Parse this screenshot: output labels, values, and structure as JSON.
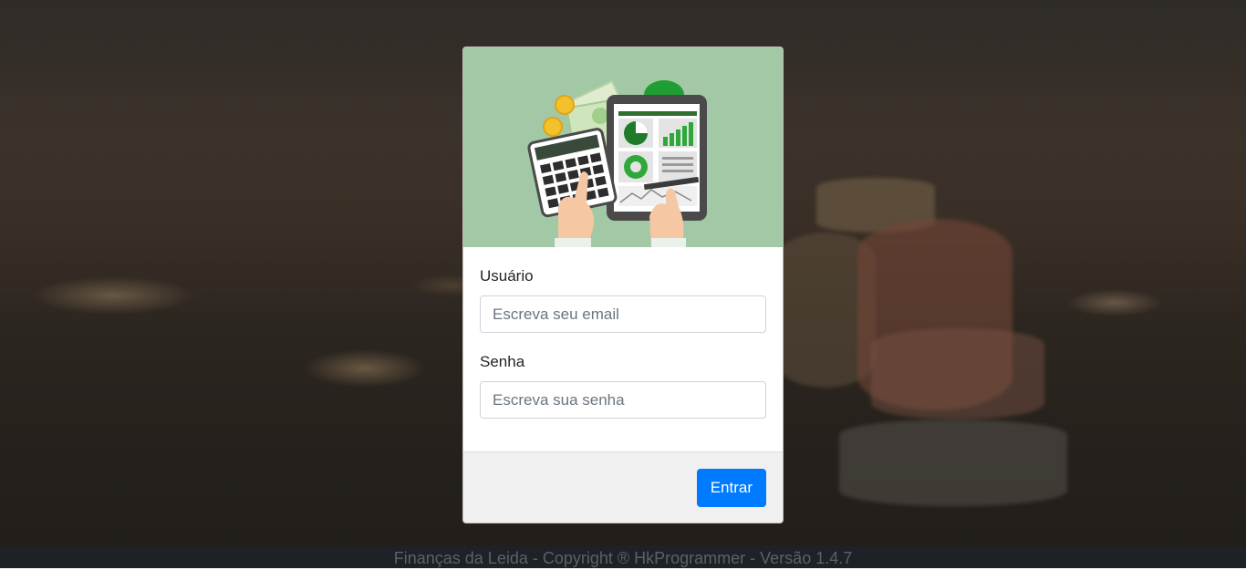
{
  "login_form": {
    "username_label": "Usuário",
    "username_placeholder": "Escreva seu email",
    "username_value": "",
    "password_label": "Senha",
    "password_placeholder": "Escreva sua senha",
    "password_value": "",
    "submit_label": "Entrar"
  },
  "footer": {
    "text": "Finanças da Leida - Copyright ® HkProgrammer - Versão 1.4.7"
  },
  "colors": {
    "primary": "#007bff",
    "illustration_background": "#a3c8a6",
    "footer_background": "#1e2226"
  },
  "illustration": {
    "icon": "finance-calculator-tablet-illustration"
  }
}
